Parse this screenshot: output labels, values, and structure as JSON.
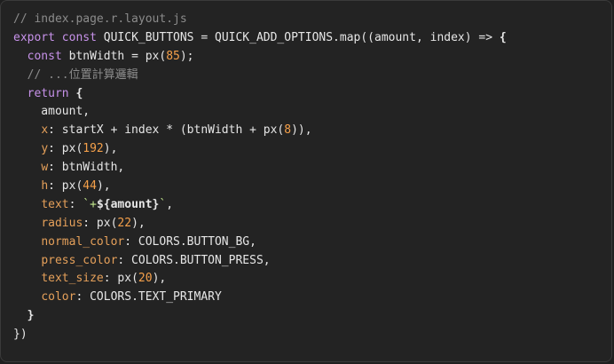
{
  "code": {
    "lines": [
      [
        {
          "t": "comment",
          "v": "// index.page.r.layout.js"
        }
      ],
      [
        {
          "t": "keyword",
          "v": "export"
        },
        {
          "t": "plain",
          "v": " "
        },
        {
          "t": "keyword",
          "v": "const"
        },
        {
          "t": "plain",
          "v": " QUICK_BUTTONS = QUICK_ADD_OPTIONS.map((amount, index) => "
        },
        {
          "t": "brace-bold",
          "v": "{"
        }
      ],
      [
        {
          "t": "plain",
          "v": "  "
        },
        {
          "t": "keyword",
          "v": "const"
        },
        {
          "t": "plain",
          "v": " btnWidth = px("
        },
        {
          "t": "number",
          "v": "85"
        },
        {
          "t": "plain",
          "v": ");"
        }
      ],
      [
        {
          "t": "plain",
          "v": "  "
        },
        {
          "t": "comment",
          "v": "// ...位置計算邏輯"
        }
      ],
      [
        {
          "t": "plain",
          "v": "  "
        },
        {
          "t": "keyword",
          "v": "return"
        },
        {
          "t": "plain",
          "v": " "
        },
        {
          "t": "brace-bold",
          "v": "{"
        }
      ],
      [
        {
          "t": "plain",
          "v": "    amount,"
        }
      ],
      [
        {
          "t": "plain",
          "v": "    "
        },
        {
          "t": "prop",
          "v": "x"
        },
        {
          "t": "plain",
          "v": ": startX + index * (btnWidth + px("
        },
        {
          "t": "number",
          "v": "8"
        },
        {
          "t": "plain",
          "v": ")),"
        }
      ],
      [
        {
          "t": "plain",
          "v": "    "
        },
        {
          "t": "prop",
          "v": "y"
        },
        {
          "t": "plain",
          "v": ": px("
        },
        {
          "t": "number",
          "v": "192"
        },
        {
          "t": "plain",
          "v": "),"
        }
      ],
      [
        {
          "t": "plain",
          "v": "    "
        },
        {
          "t": "prop",
          "v": "w"
        },
        {
          "t": "plain",
          "v": ": btnWidth,"
        }
      ],
      [
        {
          "t": "plain",
          "v": "    "
        },
        {
          "t": "prop",
          "v": "h"
        },
        {
          "t": "plain",
          "v": ": px("
        },
        {
          "t": "number",
          "v": "44"
        },
        {
          "t": "plain",
          "v": "),"
        }
      ],
      [
        {
          "t": "plain",
          "v": "    "
        },
        {
          "t": "prop",
          "v": "text"
        },
        {
          "t": "plain",
          "v": ": "
        },
        {
          "t": "string",
          "v": "`+"
        },
        {
          "t": "interp",
          "v": "${amount}"
        },
        {
          "t": "string",
          "v": "`"
        },
        {
          "t": "plain",
          "v": ","
        }
      ],
      [
        {
          "t": "plain",
          "v": "    "
        },
        {
          "t": "prop",
          "v": "radius"
        },
        {
          "t": "plain",
          "v": ": px("
        },
        {
          "t": "number",
          "v": "22"
        },
        {
          "t": "plain",
          "v": "),"
        }
      ],
      [
        {
          "t": "plain",
          "v": "    "
        },
        {
          "t": "prop",
          "v": "normal_color"
        },
        {
          "t": "plain",
          "v": ": COLORS.BUTTON_BG,"
        }
      ],
      [
        {
          "t": "plain",
          "v": "    "
        },
        {
          "t": "prop",
          "v": "press_color"
        },
        {
          "t": "plain",
          "v": ": COLORS.BUTTON_PRESS,"
        }
      ],
      [
        {
          "t": "plain",
          "v": "    "
        },
        {
          "t": "prop",
          "v": "text_size"
        },
        {
          "t": "plain",
          "v": ": px("
        },
        {
          "t": "number",
          "v": "20"
        },
        {
          "t": "plain",
          "v": "),"
        }
      ],
      [
        {
          "t": "plain",
          "v": "    "
        },
        {
          "t": "prop",
          "v": "color"
        },
        {
          "t": "plain",
          "v": ": COLORS.TEXT_PRIMARY"
        }
      ],
      [
        {
          "t": "plain",
          "v": "  "
        },
        {
          "t": "brace-bold",
          "v": "}"
        }
      ],
      [
        {
          "t": "plain",
          "v": "})"
        }
      ]
    ]
  },
  "colors": {
    "background": "#232323",
    "comment": "#8b8b8b",
    "keyword": "#c792ea",
    "property": "#e5a05a",
    "number": "#f5a04a",
    "string": "#c3e88d",
    "plain": "#e6e6e6"
  }
}
